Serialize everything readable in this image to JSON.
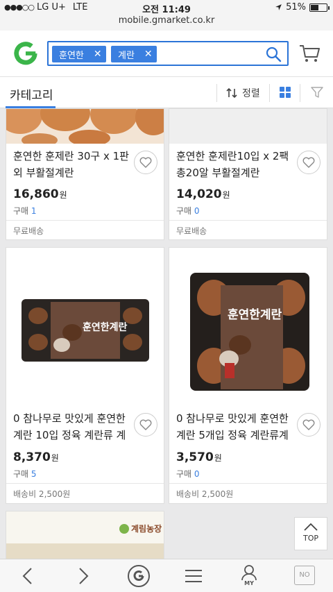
{
  "status": {
    "carrier": "LG U+",
    "network": "LTE",
    "time": "오전 11:49",
    "battery": "51%",
    "battery_level": 0.51
  },
  "url": "mobile.gmarket.co.kr",
  "search": {
    "tags": [
      "훈연한",
      "계란"
    ]
  },
  "category_bar": {
    "label": "카테고리",
    "sort_label": "정렬"
  },
  "products": [
    {
      "title_line1": "훈연한 훈제란 30구 x 1판",
      "title_line2": "외 부활절계란",
      "price": "16,860",
      "currency": "원",
      "buy_label": "구매",
      "buy_count": "1",
      "shipping": "무료배송"
    },
    {
      "title_line1": "훈연한 훈제란10입 x 2팩",
      "title_line2": "총20알 부활절계란",
      "price": "14,020",
      "currency": "원",
      "buy_label": "구매",
      "buy_count": "0",
      "shipping": "무료배송"
    },
    {
      "title_line1": "0 참나무로 맛있게 훈연한",
      "title_line2": "계란 10입 정육 계란류 계",
      "price": "8,370",
      "currency": "원",
      "buy_label": "구매",
      "buy_count": "5",
      "shipping": "배송비 2,500원",
      "package_text": "훈연한계란"
    },
    {
      "title_line1": "0 참나무로 맛있게 훈연한",
      "title_line2": "계란 5개입 정육 계란류계",
      "price": "3,570",
      "currency": "원",
      "buy_label": "구매",
      "buy_count": "0",
      "shipping": "배송비 2,500원",
      "package_text": "훈연한계란"
    }
  ],
  "partial_card": {
    "brand_text": "계림농장"
  },
  "top_button": "TOP",
  "bottom_nav": {
    "no_label": "NO",
    "my_label": "MY"
  },
  "colors": {
    "accent": "#3a7fe0",
    "logo_green": "#3bb54a",
    "search_border": "#2b74d7"
  }
}
